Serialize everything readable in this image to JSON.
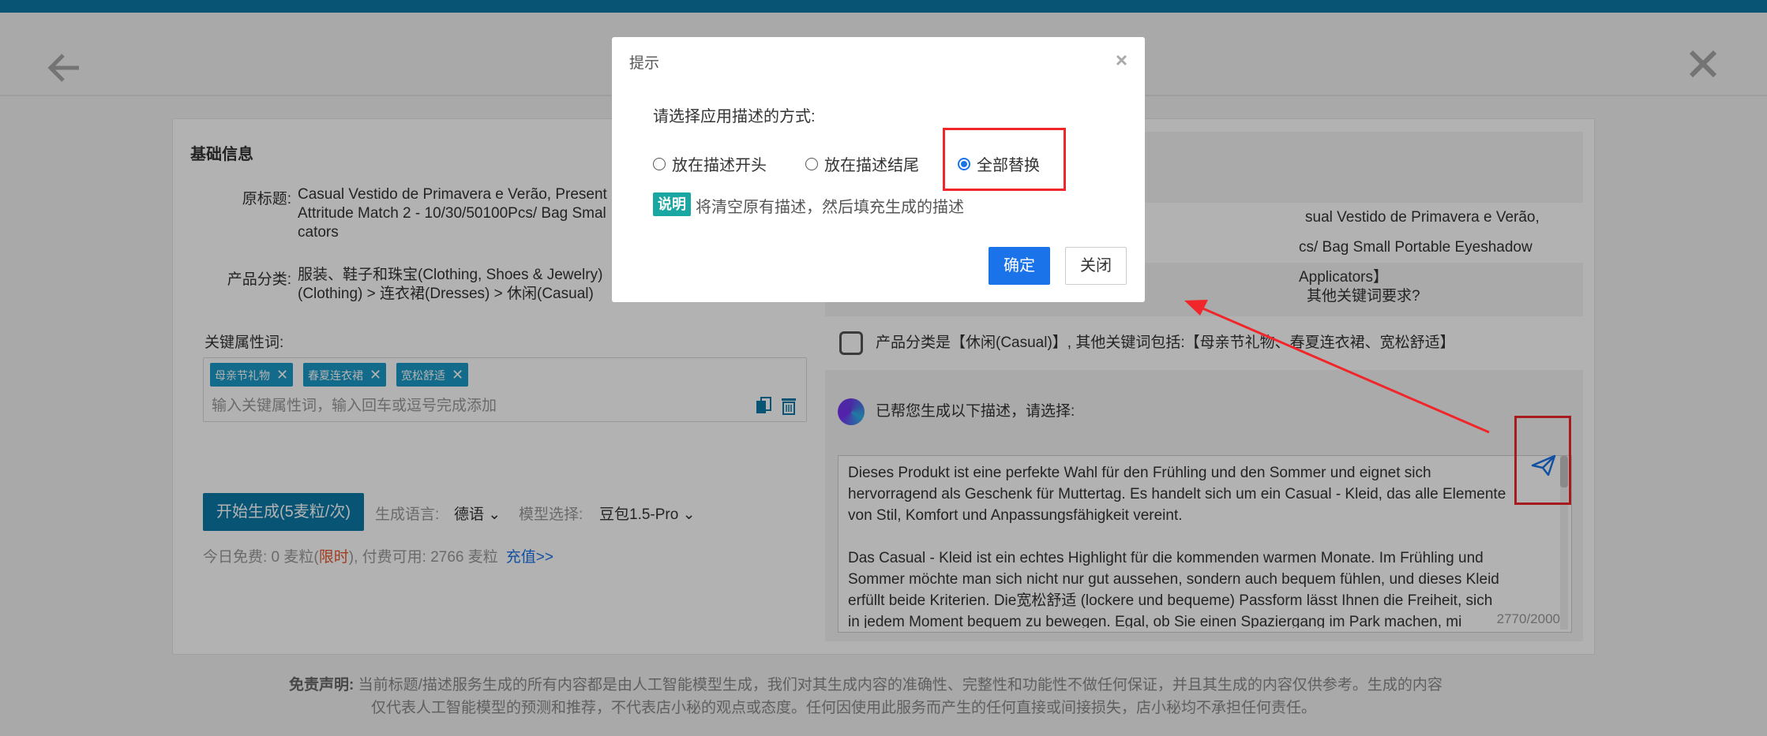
{
  "header": {
    "back_icon": "back-arrow-icon",
    "close_icon": "close-icon"
  },
  "basic": {
    "section_title": "基础信息",
    "title_label": "原标题:",
    "title_value_line1": "Casual Vestido de Primavera e Verão, Present",
    "title_value_line2": "Attritude Match 2 - 10/30/50100Pcs/ Bag Smal",
    "title_value_line3": "cators",
    "category_label": "产品分类:",
    "category_value_line1": "服装、鞋子和珠宝(Clothing, Shoes & Jewelry)",
    "category_value_line2": "(Clothing)  > 连衣裙(Dresses)  > 休闲(Casual)"
  },
  "keywords": {
    "label": "关键属性词:",
    "tags": [
      "母亲节礼物",
      "春夏连衣裙",
      "宽松舒适"
    ],
    "tag_remove": "✕",
    "placeholder": "输入关键属性词，输入回车或逗号完成添加"
  },
  "generate": {
    "button_label": "开始生成(5麦粒/次)",
    "language_label": "生成语言:",
    "language_value": "德语",
    "model_label": "模型选择:",
    "model_value": "豆包1.5-Pro",
    "free_prefix": "今日免费: 0 麦粒(",
    "free_limit": "限时",
    "free_suffix": "),  付费可用: 2766 麦粒",
    "recharge_link": "充值>>"
  },
  "chat": {
    "title_line1": "sual Vestido de Primavera e Verão, Presente para o Dia das",
    "title_line2": "cs/ Bag Small Portable Eyeshadow Applicators】",
    "question_fragment": "其他关键词要求?",
    "answer": "产品分类是【休闲(Casual)】, 其他关键词包括:【母亲节礼物、春夏连衣裙、宽松舒适】",
    "generated_intro": "已帮您生成以下描述，请选择:",
    "description": "Dieses Produkt ist eine perfekte Wahl für den Frühling und den Sommer und eignet sich\nhervorragend als Geschenk für Muttertag. Es handelt sich um ein Casual - Kleid, das alle Elemente\nvon Stil, Komfort und Anpassungsfähigkeit vereint.\n\nDas Casual - Kleid ist ein echtes Highlight für die kommenden warmen Monate. Im Frühling und\nSommer möchte man sich nicht nur gut aussehen, sondern auch bequem fühlen, und dieses Kleid\nerfüllt beide Kriterien. Die宽松舒适 (lockere und bequeme) Passform lässt Ihnen die Freiheit, sich\nin jedem Moment bequem zu bewegen. Egal, ob Sie einen Spaziergang im Park machen, mi",
    "counter": "2770/2000"
  },
  "disclaimer": {
    "label": "免责声明:",
    "line1": "当前标题/描述服务生成的所有内容都是由人工智能模型生成，我们对其生成内容的准确性、完整性和功能性不做任何保证，并且其生成的内容仅供参考。生成的内容",
    "line2": "仅代表人工智能模型的预测和推荐，不代表店小秘的观点或态度。任何因使用此服务而产生的任何直接或间接损失，店小秘均不承担任何责任。"
  },
  "dialog": {
    "title": "提示",
    "close": "×",
    "prompt": "请选择应用描述的方式:",
    "options": [
      "放在描述开头",
      "放在描述结尾",
      "全部替换"
    ],
    "selected_index": 2,
    "note_badge": "说明",
    "note_text": "将清空原有描述，然后填充生成的描述",
    "ok_label": "确定",
    "cancel_label": "关闭"
  },
  "colors": {
    "accent": "#0b79a8",
    "highlight": "#f0262a",
    "primary_button": "#1a73e8",
    "note_badge": "#1aa7a1"
  }
}
